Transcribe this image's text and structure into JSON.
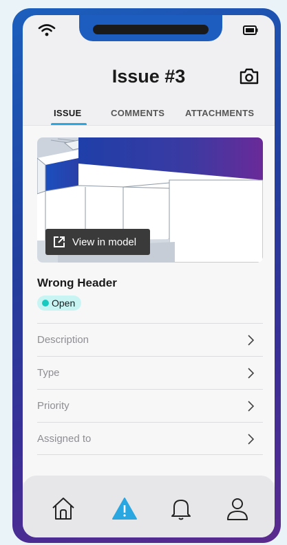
{
  "header": {
    "title": "Issue #3"
  },
  "tabs": [
    {
      "label": "ISSUE",
      "active": true
    },
    {
      "label": "COMMENTS",
      "active": false
    },
    {
      "label": "ATTACHMENTS",
      "active": false
    }
  ],
  "preview": {
    "view_in_model_label": "View in model"
  },
  "issue": {
    "name": "Wrong Header",
    "status": "Open",
    "status_color": "#19c9c0"
  },
  "fields": [
    {
      "label": "Description"
    },
    {
      "label": "Type"
    },
    {
      "label": "Priority"
    },
    {
      "label": "Assigned to"
    }
  ],
  "bottom_nav": [
    {
      "icon": "home-icon"
    },
    {
      "icon": "alert-icon",
      "active": true,
      "color": "#2aa6e0"
    },
    {
      "icon": "bell-icon"
    },
    {
      "icon": "user-icon"
    }
  ],
  "colors": {
    "accent": "#2aa6e0",
    "frame_gradient_start": "#1c5fbd",
    "frame_gradient_end": "#5b2a8e"
  }
}
